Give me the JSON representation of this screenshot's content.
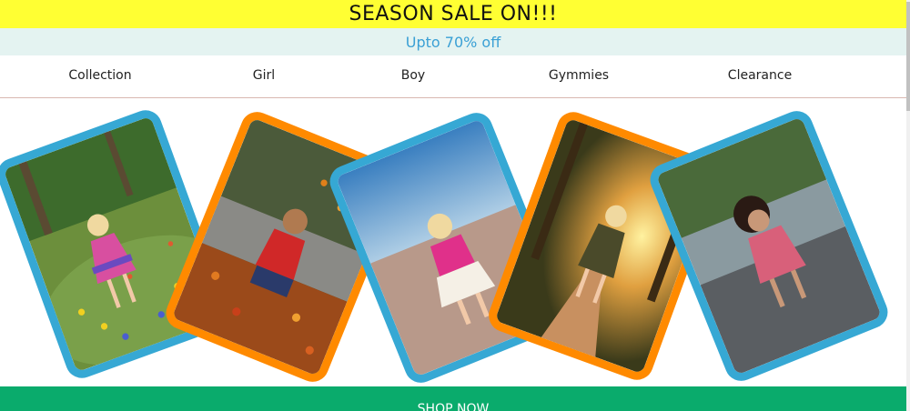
{
  "banner": {
    "sale_text": "SEASON SALE ON!!!",
    "offer_text": "Upto 70% off"
  },
  "nav": {
    "items": [
      {
        "label": "Collection"
      },
      {
        "label": "Girl"
      },
      {
        "label": "Boy"
      },
      {
        "label": "Gymmies"
      },
      {
        "label": "Clearance"
      }
    ]
  },
  "gallery": {
    "photos": [
      {
        "subject": "girl in flower field",
        "frame_color": "#36a8d4"
      },
      {
        "subject": "boy in autumn leaves",
        "frame_color": "#ff8a00"
      },
      {
        "subject": "girl on beach",
        "frame_color": "#36a8d4"
      },
      {
        "subject": "girl on sunset path",
        "frame_color": "#ff8a00"
      },
      {
        "subject": "girl jumping on street",
        "frame_color": "#36a8d4"
      }
    ]
  },
  "cta": {
    "shop_label": "SHOP NOW"
  },
  "colors": {
    "sale_banner": "#ffff33",
    "offer_banner": "#e4f3f1",
    "offer_text": "#3aa0d5",
    "cta_bar": "#0aab6c",
    "frame_blue": "#36a8d4",
    "frame_orange": "#ff8a00"
  }
}
